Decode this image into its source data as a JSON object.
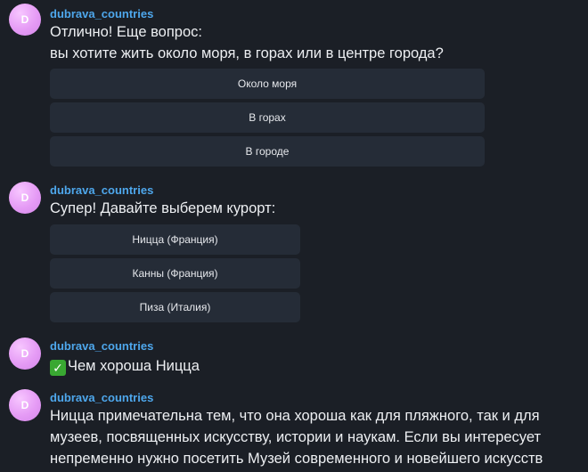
{
  "messages": [
    {
      "avatar": "D",
      "author": "dubrava_countries",
      "lines": [
        "Отлично! Еще вопрос:",
        "вы хотите жить около моря, в горах или в центре города?"
      ],
      "buttons": [
        "Около моря",
        "В горах",
        "В городе"
      ]
    },
    {
      "avatar": "D",
      "author": "dubrava_countries",
      "lines": [
        "Супер! Давайте выберем курорт:"
      ],
      "buttons": [
        "Ницца (Франция)",
        "Канны (Франция)",
        "Пиза (Италия)"
      ]
    },
    {
      "avatar": "D",
      "author": "dubrava_countries",
      "check_icon": "check-mark-button-emoji",
      "lines": [
        "Чем хороша Ницца"
      ]
    },
    {
      "avatar": "D",
      "author": "dubrava_countries",
      "lines": [
        "Ницца примечательна тем, что она хороша как для пляжного, так и для",
        "музеев, посвященных искусству, истории и наукам. Если вы интересует",
        "непременно нужно посетить Музей современного и новейшего искусств"
      ]
    }
  ],
  "colors": {
    "background": "#1b1f26",
    "author": "#4ea7ec",
    "button_bg": "#252c37",
    "avatar": "#e59bf5",
    "check": "#39a832"
  }
}
